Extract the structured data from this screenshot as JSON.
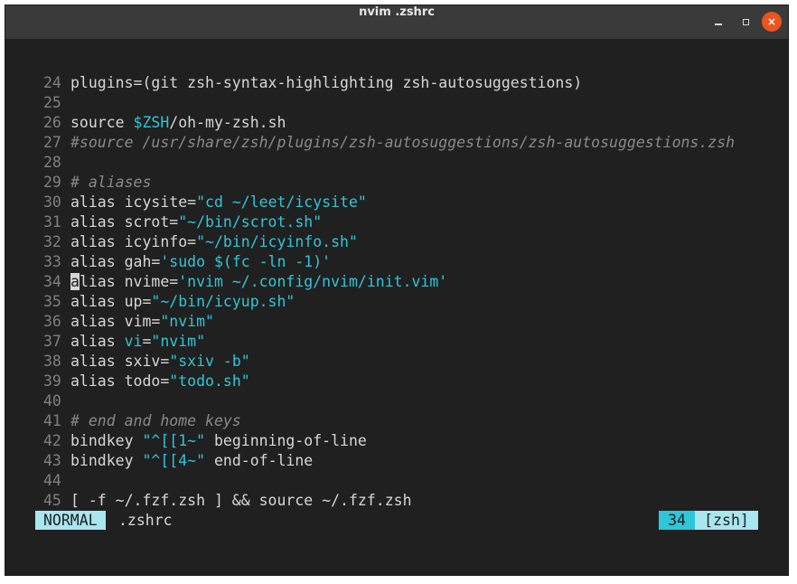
{
  "window": {
    "title": "nvim .zshrc",
    "minimize_icon": "minimize-icon",
    "maximize_icon": "maximize-icon",
    "close_label": "×",
    "close_color": "#e95420"
  },
  "editor": {
    "lines": [
      {
        "num": "24",
        "segments": [
          {
            "t": "plugins=(git zsh-syntax-highlighting zsh-autosuggestions)",
            "c": "plain"
          }
        ]
      },
      {
        "num": "25",
        "segments": []
      },
      {
        "num": "26",
        "segments": [
          {
            "t": "source ",
            "c": "kw"
          },
          {
            "t": "$ZSH",
            "c": "var"
          },
          {
            "t": "/oh-my-zsh.sh",
            "c": "plain"
          }
        ]
      },
      {
        "num": "27",
        "segments": [
          {
            "t": "#source /usr/share/zsh/plugins/zsh-autosuggestions/zsh-autosuggestions.zsh",
            "c": "cmt"
          }
        ]
      },
      {
        "num": "28",
        "segments": []
      },
      {
        "num": "29",
        "segments": [
          {
            "t": "# aliases",
            "c": "cmt"
          }
        ]
      },
      {
        "num": "30",
        "segments": [
          {
            "t": "alias ",
            "c": "kw"
          },
          {
            "t": "icysite=",
            "c": "plain"
          },
          {
            "t": "\"cd ~/leet/icysite\"",
            "c": "str"
          }
        ]
      },
      {
        "num": "31",
        "segments": [
          {
            "t": "alias ",
            "c": "kw"
          },
          {
            "t": "scrot=",
            "c": "plain"
          },
          {
            "t": "\"~/bin/scrot.sh\"",
            "c": "str"
          }
        ]
      },
      {
        "num": "32",
        "segments": [
          {
            "t": "alias ",
            "c": "kw"
          },
          {
            "t": "icyinfo=",
            "c": "plain"
          },
          {
            "t": "\"~/bin/icyinfo.sh\"",
            "c": "str"
          }
        ]
      },
      {
        "num": "33",
        "segments": [
          {
            "t": "alias ",
            "c": "kw"
          },
          {
            "t": "gah=",
            "c": "plain"
          },
          {
            "t": "'sudo $(fc -ln -1)'",
            "c": "str"
          }
        ]
      },
      {
        "num": "34",
        "segments": [
          {
            "t": "a",
            "c": "cursor"
          },
          {
            "t": "lias ",
            "c": "kw"
          },
          {
            "t": "nvime=",
            "c": "plain"
          },
          {
            "t": "'nvim ~/.config/nvim/init.vim'",
            "c": "str"
          }
        ]
      },
      {
        "num": "35",
        "segments": [
          {
            "t": "alias ",
            "c": "kw"
          },
          {
            "t": "up=",
            "c": "plain"
          },
          {
            "t": "\"~/bin/icyup.sh\"",
            "c": "str"
          }
        ]
      },
      {
        "num": "36",
        "segments": [
          {
            "t": "alias ",
            "c": "kw"
          },
          {
            "t": "vim=",
            "c": "plain"
          },
          {
            "t": "\"nvim\"",
            "c": "str"
          }
        ]
      },
      {
        "num": "37",
        "segments": [
          {
            "t": "alias ",
            "c": "kw"
          },
          {
            "t": "vi",
            "c": "var"
          },
          {
            "t": "=",
            "c": "plain"
          },
          {
            "t": "\"nvim\"",
            "c": "str"
          }
        ]
      },
      {
        "num": "38",
        "segments": [
          {
            "t": "alias ",
            "c": "kw"
          },
          {
            "t": "sxiv=",
            "c": "plain"
          },
          {
            "t": "\"sxiv -b\"",
            "c": "str"
          }
        ]
      },
      {
        "num": "39",
        "segments": [
          {
            "t": "alias ",
            "c": "kw"
          },
          {
            "t": "todo=",
            "c": "plain"
          },
          {
            "t": "\"todo.sh\"",
            "c": "str"
          }
        ]
      },
      {
        "num": "40",
        "segments": []
      },
      {
        "num": "41",
        "segments": [
          {
            "t": "# end and home keys",
            "c": "cmt"
          }
        ]
      },
      {
        "num": "42",
        "segments": [
          {
            "t": "bindkey ",
            "c": "kw"
          },
          {
            "t": "\"^[[1~\"",
            "c": "str"
          },
          {
            "t": " beginning-of-line",
            "c": "plain"
          }
        ]
      },
      {
        "num": "43",
        "segments": [
          {
            "t": "bindkey ",
            "c": "kw"
          },
          {
            "t": "\"^[[4~\"",
            "c": "str"
          },
          {
            "t": " end-of-line",
            "c": "plain"
          }
        ]
      },
      {
        "num": "44",
        "segments": []
      },
      {
        "num": "45",
        "segments": [
          {
            "t": "[ -f ~/.fzf.zsh ] && ",
            "c": "plain"
          },
          {
            "t": "source",
            "c": "kw"
          },
          {
            "t": " ~/.fzf.zsh",
            "c": "plain"
          }
        ]
      }
    ]
  },
  "statusline": {
    "mode": "NORMAL",
    "filename": ".zshrc",
    "line_number": "34",
    "filetype": "[zsh]"
  },
  "colors": {
    "background": "#202020",
    "string": "#2ec6d9",
    "comment": "#8a8a8a",
    "mode_bg": "#a8e6f0"
  }
}
